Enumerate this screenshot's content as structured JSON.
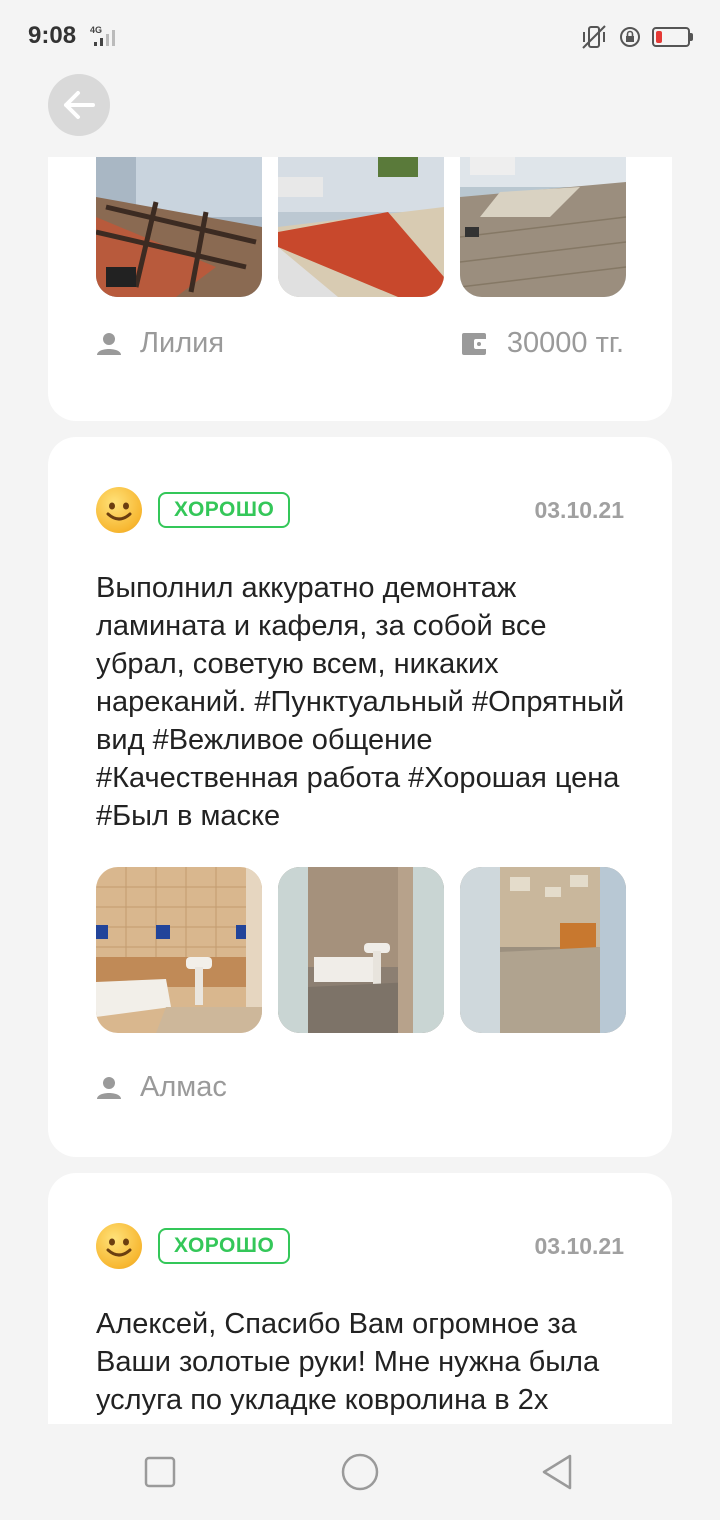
{
  "status_bar": {
    "time": "9:08",
    "network": "4G"
  },
  "header": {
    "back_icon": "arrow-left-icon"
  },
  "reviews": [
    {
      "author": "Лилия",
      "price": "30000 тг."
    },
    {
      "rating_label": "ХОРОШО",
      "date": "03.10.21",
      "text": "Выполнил аккуратно демонтаж ламината и кафеля, за собой все убрал, советую всем, никаких нареканий.  #Пунктуальный #Опрятный вид #Вежливое общение #Качественная работа #Хорошая цена #Был в маске",
      "author": "Алмас"
    },
    {
      "rating_label": "ХОРОШО",
      "date": "03.10.21",
      "text": "Алексей, Спасибо Вам огромное за Ваши золотые руки! Мне нужна была услуга по укладке ковролина в 2х"
    }
  ],
  "colors": {
    "accent_green": "#34c759",
    "background": "#f4f4f4",
    "card": "#ffffff"
  },
  "nav": {
    "icons": [
      "square-icon",
      "circle-icon",
      "triangle-back-icon"
    ]
  }
}
